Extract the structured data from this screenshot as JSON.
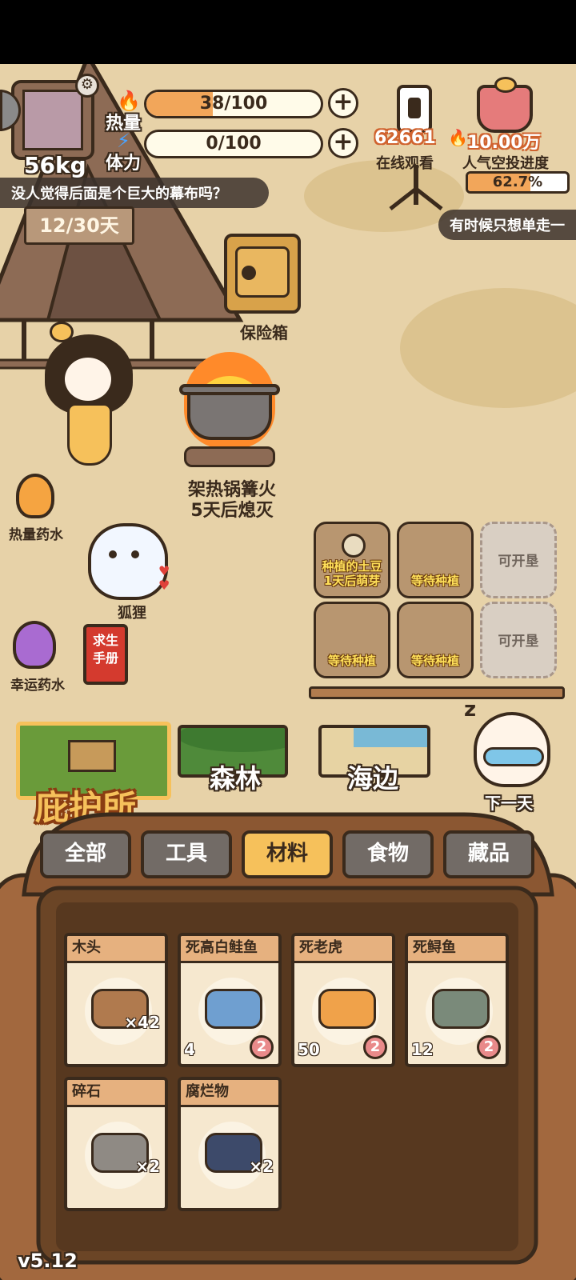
{
  "status_bar": {
    "background": "#000000"
  },
  "player": {
    "weight": "56kg",
    "day_counter": "12/30天"
  },
  "stats": {
    "calorie_label": "热量",
    "calorie_value": "38/100",
    "calorie_fraction": 0.38,
    "stamina_label": "体力",
    "stamina_value": "0/100",
    "stamina_fraction": 0.0
  },
  "live": {
    "viewers": "62661",
    "viewers_label": "在线观看",
    "airdrop_count": "10.00万",
    "airdrop_label": "人气空投进度",
    "airdrop_percent": "62.7%",
    "airdrop_fraction": 0.627
  },
  "speech": {
    "left": "没人觉得后面是个巨大的幕布吗？",
    "right": "有时候只想单走一"
  },
  "scene": {
    "safe_label": "保险箱",
    "campfire_label_1": "架热锅篝火",
    "campfire_label_2": "5天后熄灭",
    "calorie_potion": "热量药水",
    "fox_label": "狐狸",
    "luck_potion": "幸运药水",
    "manual": "求生手册"
  },
  "plots": [
    {
      "label": "种植的土豆\n1天后萌芽",
      "state": "growing"
    },
    {
      "label": "等待种植",
      "state": "empty"
    },
    {
      "label": "可开垦",
      "state": "locked"
    },
    {
      "label": "等待种植",
      "state": "empty"
    },
    {
      "label": "等待种植",
      "state": "empty"
    },
    {
      "label": "可开垦",
      "state": "locked"
    }
  ],
  "locations": {
    "shelter": "庇护所",
    "forest": "森林",
    "seaside": "海边",
    "next_day": "下一天"
  },
  "categories": [
    {
      "label": "全部"
    },
    {
      "label": "工具"
    },
    {
      "label": "材料",
      "active": true
    },
    {
      "label": "食物"
    },
    {
      "label": "藏品"
    }
  ],
  "items": [
    {
      "name": "木头",
      "count": "×42",
      "stat": "",
      "badge": ""
    },
    {
      "name": "死高白鲑鱼",
      "count": "",
      "stat": "4",
      "badge": "2"
    },
    {
      "name": "死老虎",
      "count": "",
      "stat": "50",
      "badge": "2"
    },
    {
      "name": "死鲟鱼",
      "count": "",
      "stat": "12",
      "badge": "2"
    },
    {
      "name": "碎石",
      "count": "×2",
      "stat": "",
      "badge": ""
    },
    {
      "name": "腐烂物",
      "count": "×2",
      "stat": "",
      "badge": ""
    }
  ],
  "version": "v5.12",
  "colors": {
    "accent": "#f6c15b",
    "bar_fill": "#f2a65a",
    "dark": "#3a2a1c"
  }
}
